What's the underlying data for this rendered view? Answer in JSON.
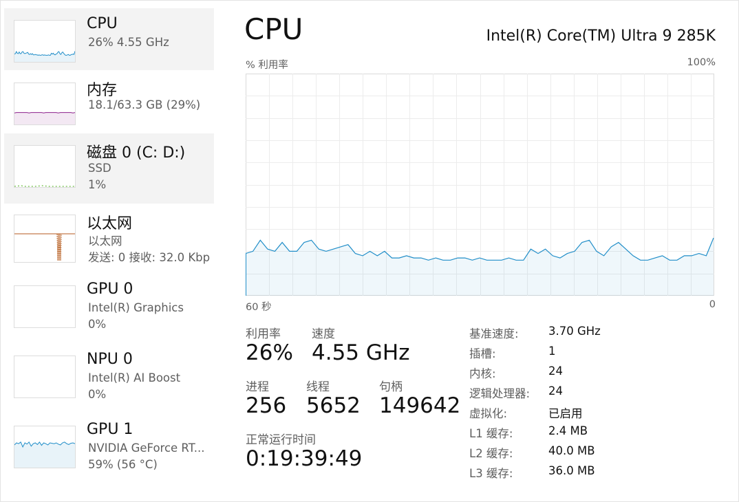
{
  "sidebar": {
    "items": [
      {
        "name": "CPU",
        "line1": "26%  4.55 GHz",
        "line2": "",
        "color": "#1f8dc8",
        "selected": true
      },
      {
        "name": "内存",
        "line1": "18.1/63.3 GB (29%)",
        "line2": "",
        "color": "#8b1e8b",
        "selected": false
      },
      {
        "name": "磁盘 0 (C: D:)",
        "line1": "SSD",
        "line2": "1%",
        "color": "#4caf1a",
        "selected": true
      },
      {
        "name": "以太网",
        "line1": "以太网",
        "line2": "发送: 0 接收: 32.0 Kbp",
        "color": "#b55a1c",
        "selected": false
      },
      {
        "name": "GPU 0",
        "line1": "Intel(R) Graphics",
        "line2": "0%",
        "color": "#1f8dc8",
        "selected": false
      },
      {
        "name": "NPU 0",
        "line1": "Intel(R) AI Boost",
        "line2": "0%",
        "color": "#1f8dc8",
        "selected": false
      },
      {
        "name": "GPU 1",
        "line1": "NVIDIA GeForce RT...",
        "line2": "59% (56 °C)",
        "color": "#1f8dc8",
        "selected": false
      }
    ]
  },
  "main": {
    "title": "CPU",
    "model": "Intel(R) Core(TM) Ultra 9 285K",
    "graph": {
      "y_label": "% 利用率",
      "y_max_label": "100%",
      "x_left_label": "60 秒",
      "x_right_label": "0",
      "color": "#1f8dc8",
      "values": [
        19,
        20,
        25,
        21,
        20,
        24,
        20,
        20,
        24,
        25,
        21,
        20,
        21,
        22,
        23,
        19,
        18,
        20,
        18,
        20,
        17,
        17,
        18,
        17,
        17,
        16,
        17,
        16,
        16,
        17,
        17,
        16,
        17,
        16,
        16,
        16,
        17,
        16,
        16,
        21,
        19,
        21,
        18,
        17,
        19,
        20,
        24,
        25,
        20,
        18,
        22,
        24,
        21,
        18,
        16,
        16,
        17,
        18,
        16,
        16,
        18,
        18,
        19,
        18,
        26
      ]
    },
    "stats": {
      "util_label": "利用率",
      "util_value": "26%",
      "speed_label": "速度",
      "speed_value": "4.55 GHz",
      "proc_label": "进程",
      "proc_value": "256",
      "thread_label": "线程",
      "thread_value": "5652",
      "handle_label": "句柄",
      "handle_value": "149642",
      "uptime_label": "正常运行时间",
      "uptime_value": "0:19:39:49"
    },
    "details": [
      {
        "k": "基准速度:",
        "v": "3.70 GHz"
      },
      {
        "k": "插槽:",
        "v": "1"
      },
      {
        "k": "内核:",
        "v": "24"
      },
      {
        "k": "逻辑处理器:",
        "v": "24"
      },
      {
        "k": "虚拟化:",
        "v": "已启用"
      },
      {
        "k": "L1 缓存:",
        "v": "2.4 MB"
      },
      {
        "k": "L2 缓存:",
        "v": "40.0 MB"
      },
      {
        "k": "L3 缓存:",
        "v": "36.0 MB"
      }
    ]
  }
}
